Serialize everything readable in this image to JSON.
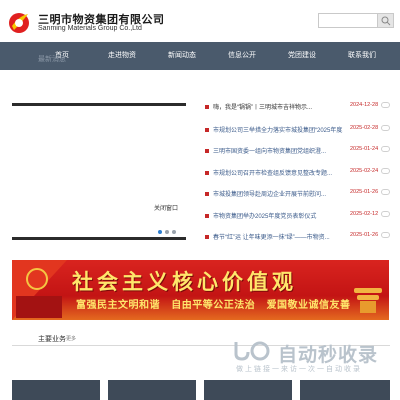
{
  "header": {
    "brand_cn": "三明市物资集团有限公司",
    "brand_en": "Sanming Materials Group Co.,Ltd",
    "search_placeholder": ""
  },
  "nav": {
    "items": [
      {
        "label": "首页"
      },
      {
        "label": "走进物资"
      },
      {
        "label": "新闻动态"
      },
      {
        "label": "信息公开"
      },
      {
        "label": "党团建设"
      },
      {
        "label": "联系我们"
      }
    ]
  },
  "breadcrumb": "最新消息",
  "banner": {
    "caption": "关闭窗口"
  },
  "news": [
    {
      "title": "嗨，我是“锅锅”丨三明城市吉祥物示...",
      "date": "2024-12-28"
    },
    {
      "title": "市规划公司三举措全力落实市城投集团“2025年度...",
      "date": "2025-02-28"
    },
    {
      "title": "三明市国资委一组向市物资集团党组织澄...",
      "date": "2025-01-24"
    },
    {
      "title": "市规划公司召开市检查组反馈意见整改专题...",
      "date": "2025-02-24"
    },
    {
      "title": "市城投集团领导赴周边企业开展节前慰问...",
      "date": "2025-01-26"
    },
    {
      "title": "市物资集团举办2025年度党员表彰仪式",
      "date": "2025-02-12"
    },
    {
      "title": "春节“红”运 让年味更添一抹“绿”——市物资...",
      "date": "2025-01-26"
    }
  ],
  "red_banner": {
    "main": "社会主义核心价值观",
    "sub": [
      "富强民主文明和谐",
      "自由平等公正法治",
      "爱国敬业诚信友善"
    ]
  },
  "section": {
    "title": "主要业务",
    "more": "更多"
  },
  "watermark": {
    "text": "自动秒收录",
    "sub": "做上链接一来访一次一自动收录"
  },
  "colors": {
    "nav_bg": "#4a5a6c",
    "accent_red": "#c8151b",
    "slogan_yellow": "#ffe66b",
    "date_red": "#c62828"
  }
}
